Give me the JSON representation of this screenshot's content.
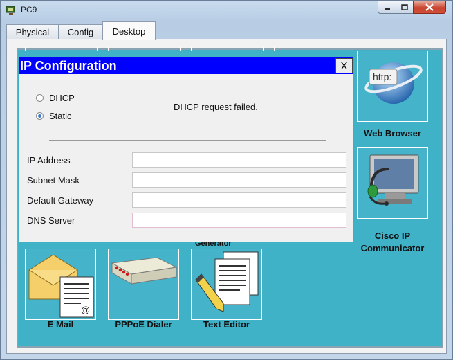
{
  "window": {
    "title": "PC9"
  },
  "tabs": [
    {
      "label": "Physical",
      "active": false
    },
    {
      "label": "Config",
      "active": false
    },
    {
      "label": "Desktop",
      "active": true
    }
  ],
  "desktop": {
    "apps": [
      {
        "label": "Web Browser",
        "icon": "web-browser-icon"
      },
      {
        "label": "Cisco IP Communicator",
        "line1": "Cisco IP",
        "line2": "Communicator",
        "icon": "ip-phone-icon"
      },
      {
        "label": "E Mail",
        "icon": "email-icon"
      },
      {
        "label": "PPPoE Dialer",
        "icon": "pppoe-dialer-icon"
      },
      {
        "label": "Text Editor",
        "icon": "text-editor-icon"
      }
    ],
    "partially_hidden_label": "Generator"
  },
  "dialog": {
    "title": "IP Configuration",
    "close_label": "X",
    "mode": {
      "options": [
        "DHCP",
        "Static"
      ],
      "selected": "Static"
    },
    "status_text": "DHCP request failed.",
    "fields": [
      {
        "label": "IP Address",
        "value": ""
      },
      {
        "label": "Subnet Mask",
        "value": ""
      },
      {
        "label": "Default Gateway",
        "value": ""
      },
      {
        "label": "DNS Server",
        "value": ""
      }
    ]
  },
  "colors": {
    "desktop_bg": "#40b2c8",
    "dialog_title_bg": "#0000ff",
    "close_button": "#c7432d"
  }
}
